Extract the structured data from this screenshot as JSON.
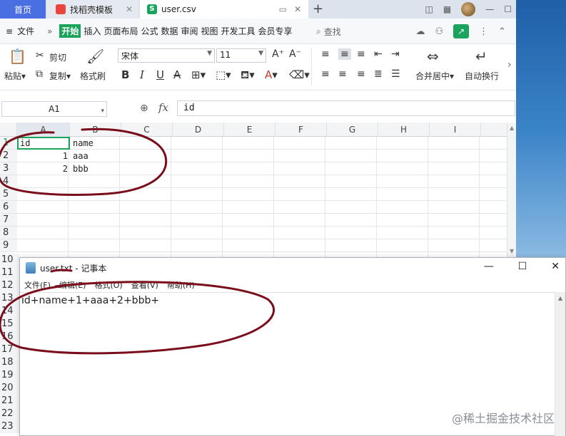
{
  "tabs": {
    "home": "首页",
    "template": "找稻壳模板",
    "file": "user.csv",
    "file_badge": "S"
  },
  "menu": {
    "file": "文件",
    "more": "»",
    "items": [
      "开始",
      "插入",
      "页面布局",
      "公式",
      "数据",
      "审阅",
      "视图",
      "开发工具",
      "会员专享"
    ],
    "search": "查找"
  },
  "ribbon": {
    "paste": "粘贴",
    "cut": "剪切",
    "copy": "复制",
    "format_painter": "格式刷",
    "font_name": "宋体",
    "font_size": "11",
    "merge_center": "合并居中",
    "wrap_text": "自动换行"
  },
  "formula": {
    "name_box": "A1",
    "fx": "fx",
    "value": "id"
  },
  "grid": {
    "columns": [
      "A",
      "B",
      "C",
      "D",
      "E",
      "F",
      "G",
      "H",
      "I"
    ],
    "rows_top": [
      "1",
      "2",
      "3",
      "4",
      "5",
      "6",
      "7",
      "8",
      "9"
    ],
    "rows_bottom": [
      "10",
      "11",
      "12",
      "13",
      "14",
      "15",
      "16",
      "17",
      "18",
      "19",
      "20",
      "21",
      "22",
      "23"
    ],
    "cells": {
      "a1": "id",
      "b1": "name",
      "a2": "1",
      "b2": "aaa",
      "a3": "2",
      "b3": "bbb"
    }
  },
  "notepad": {
    "title": "user.txt - 记事本",
    "menu": [
      "文件(F)",
      "编辑(E)",
      "格式(O)",
      "查看(V)",
      "帮助(H)"
    ],
    "content": "id+name+1+aaa+2+bbb+"
  },
  "watermark": "@稀土掘金技术社区",
  "colors": {
    "accent_green": "#1aa35a",
    "home_tab_blue": "#4a6fe3",
    "annotation_red": "#7a0d1c"
  }
}
